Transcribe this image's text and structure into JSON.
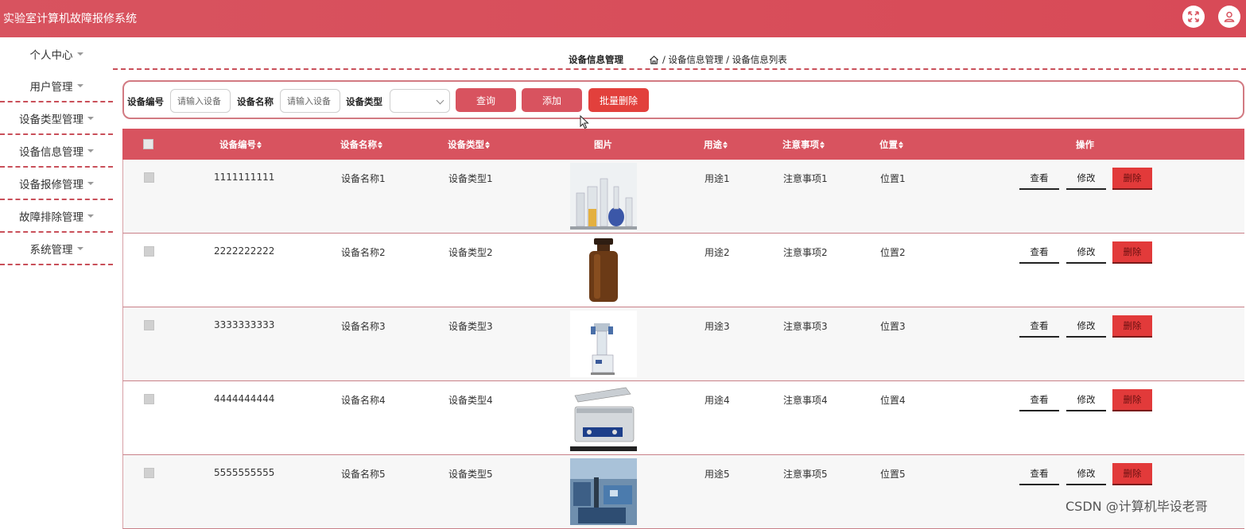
{
  "header": {
    "title": "实验室计算机故障报修系统",
    "fullscreen_icon": "expand-icon",
    "user_icon": "user-icon",
    "accent": "#d8535f"
  },
  "sidebar": {
    "items": [
      {
        "label": "个人中心"
      },
      {
        "label": "用户管理"
      },
      {
        "label": "设备类型管理"
      },
      {
        "label": "设备信息管理"
      },
      {
        "label": "设备报修管理"
      },
      {
        "label": "故障排除管理"
      },
      {
        "label": "系统管理"
      }
    ]
  },
  "breadcrumb": {
    "page_title": "设备信息管理",
    "path": "/ 设备信息管理 / 设备信息列表",
    "home_icon": "home-icon"
  },
  "search": {
    "code_label": "设备编号",
    "code_placeholder": "请输入设备",
    "name_label": "设备名称",
    "name_placeholder": "请输入设备",
    "type_label": "设备类型",
    "type_value": "",
    "query_label": "查询",
    "add_label": "添加",
    "batch_delete_label": "批量删除"
  },
  "table": {
    "columns": {
      "code": "设备编号",
      "name": "设备名称",
      "type": "设备类型",
      "image": "图片",
      "usage": "用途",
      "notes": "注意事项",
      "location": "位置",
      "actions": "操作"
    },
    "rows": [
      {
        "code": "1111111111",
        "name": "设备名称1",
        "type": "设备类型1",
        "usage": "用途1",
        "notes": "注意事项1",
        "location": "位置1"
      },
      {
        "code": "2222222222",
        "name": "设备名称2",
        "type": "设备类型2",
        "usage": "用途2",
        "notes": "注意事项2",
        "location": "位置2"
      },
      {
        "code": "3333333333",
        "name": "设备名称3",
        "type": "设备类型3",
        "usage": "用途3",
        "notes": "注意事项3",
        "location": "位置3"
      },
      {
        "code": "4444444444",
        "name": "设备名称4",
        "type": "设备类型4",
        "usage": "用途4",
        "notes": "注意事项4",
        "location": "位置4"
      },
      {
        "code": "5555555555",
        "name": "设备名称5",
        "type": "设备类型5",
        "usage": "用途5",
        "notes": "注意事项5",
        "location": "位置5"
      }
    ],
    "view_label": "查看",
    "edit_label": "修改",
    "delete_label": "删除"
  },
  "watermark": "CSDN @计算机毕设老哥"
}
